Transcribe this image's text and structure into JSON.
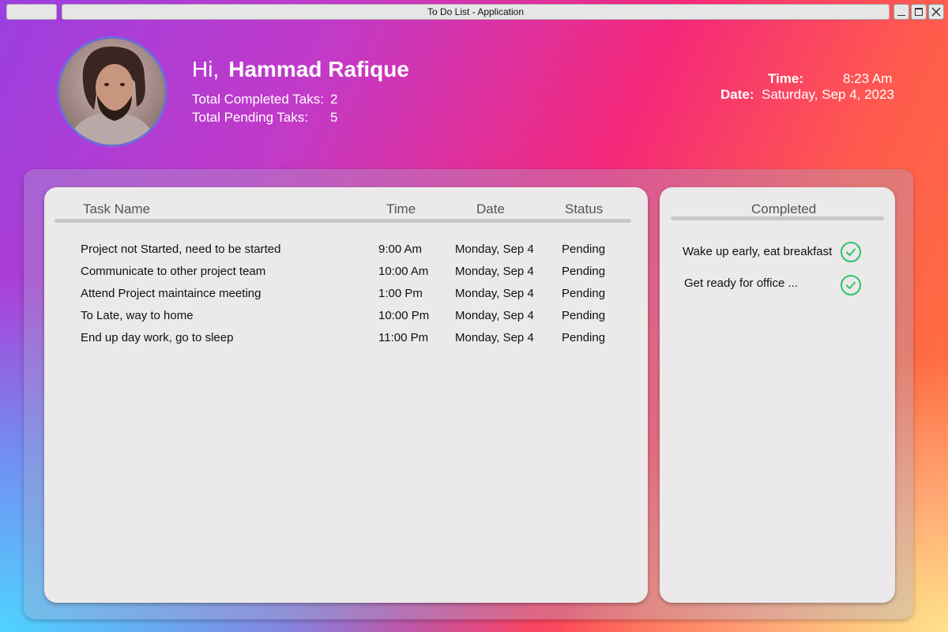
{
  "window": {
    "title": "To Do List - Application"
  },
  "user": {
    "greeting": "Hi,",
    "name": "Hammad Rafique",
    "completed_label": "Total Completed Taks:",
    "completed_count": "2",
    "pending_label": "Total Pending Taks:",
    "pending_count": "5"
  },
  "clock": {
    "time_label": "Time:",
    "time_value": "8:23 Am",
    "date_label": "Date:",
    "date_value": "Saturday, Sep 4, 2023"
  },
  "tasks": {
    "columns": [
      "Task Name",
      "Time",
      "Date",
      "Status"
    ],
    "rows": [
      {
        "name": "Project not Started, need to be started",
        "time": "9:00 Am",
        "date": "Monday, Sep 4",
        "status": "Pending"
      },
      {
        "name": "Communicate to other project team",
        "time": "10:00 Am",
        "date": "Monday, Sep 4",
        "status": "Pending"
      },
      {
        "name": "Attend Project maintaince meeting",
        "time": "1:00 Pm",
        "date": "Monday, Sep 4",
        "status": "Pending"
      },
      {
        "name": "To Late, way to home",
        "time": "10:00 Pm",
        "date": "Monday, Sep 4",
        "status": "Pending"
      },
      {
        "name": "End up day work, go to sleep",
        "time": "11:00 Pm",
        "date": "Monday, Sep 4",
        "status": "Pending"
      }
    ]
  },
  "completed": {
    "title": "Completed",
    "items": [
      {
        "name": "Wake up early, eat breakfast",
        "icon": "check-circle-icon"
      },
      {
        "name": "Get ready for office ...",
        "icon": "check-circle-icon"
      }
    ]
  },
  "colors": {
    "check": "#2fc36a",
    "panel": "#ebe9e9"
  }
}
